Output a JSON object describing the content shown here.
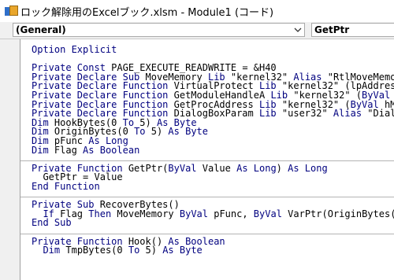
{
  "window": {
    "title": "ロック解除用のExcelブック.xlsm - Module1 (コード)",
    "icon": "vba-module-icon"
  },
  "toolbar": {
    "object_combo": "(General)",
    "procedure_combo": "GetPtr"
  },
  "colors": {
    "keyword": "#00007f",
    "text": "#000000",
    "gutter": "#f0f0f0",
    "divider": "#b4b4b4"
  },
  "code": [
    [
      {
        "t": "Option Explicit",
        "k": 1
      }
    ],
    [],
    [
      {
        "t": "Private Const",
        "k": 1
      },
      {
        "t": " PAGE_EXECUTE_READWRITE = &H40"
      }
    ],
    [
      {
        "t": "Private Declare Sub",
        "k": 1
      },
      {
        "t": " MoveMemory "
      },
      {
        "t": "Lib",
        "k": 1
      },
      {
        "t": " \"kernel32\" "
      },
      {
        "t": "Alias",
        "k": 1
      },
      {
        "t": " \"RtlMoveMemory"
      }
    ],
    [
      {
        "t": "Private Declare Function",
        "k": 1
      },
      {
        "t": " VirtualProtect "
      },
      {
        "t": "Lib",
        "k": 1
      },
      {
        "t": " \"kernel32\" (lpAddress "
      }
    ],
    [
      {
        "t": "Private Declare Function",
        "k": 1
      },
      {
        "t": " GetModuleHandleA "
      },
      {
        "t": "Lib",
        "k": 1
      },
      {
        "t": " \"kernel32\" ("
      },
      {
        "t": "ByVal",
        "k": 1
      },
      {
        "t": " lp"
      }
    ],
    [
      {
        "t": "Private Declare Function",
        "k": 1
      },
      {
        "t": " GetProcAddress "
      },
      {
        "t": "Lib",
        "k": 1
      },
      {
        "t": " \"kernel32\" ("
      },
      {
        "t": "ByVal",
        "k": 1
      },
      {
        "t": " hMod"
      }
    ],
    [
      {
        "t": "Private Declare Function",
        "k": 1
      },
      {
        "t": " DialogBoxParam "
      },
      {
        "t": "Lib",
        "k": 1
      },
      {
        "t": " \"user32\" "
      },
      {
        "t": "Alias",
        "k": 1
      },
      {
        "t": " \"Dialog"
      }
    ],
    [
      {
        "t": "Dim",
        "k": 1
      },
      {
        "t": " HookBytes(0 "
      },
      {
        "t": "To",
        "k": 1
      },
      {
        "t": " 5) "
      },
      {
        "t": "As Byte",
        "k": 1
      }
    ],
    [
      {
        "t": "Dim",
        "k": 1
      },
      {
        "t": " OriginBytes(0 "
      },
      {
        "t": "To",
        "k": 1
      },
      {
        "t": " 5) "
      },
      {
        "t": "As Byte",
        "k": 1
      }
    ],
    [
      {
        "t": "Dim",
        "k": 1
      },
      {
        "t": " pFunc "
      },
      {
        "t": "As Long",
        "k": 1
      }
    ],
    [
      {
        "t": "Dim",
        "k": 1
      },
      {
        "t": " Flag "
      },
      {
        "t": "As Boolean",
        "k": 1
      }
    ],
    [],
    [
      {
        "t": "Private Function",
        "k": 1
      },
      {
        "t": " GetPtr("
      },
      {
        "t": "ByVal",
        "k": 1
      },
      {
        "t": " Value "
      },
      {
        "t": "As Long",
        "k": 1
      },
      {
        "t": ") "
      },
      {
        "t": "As Long",
        "k": 1
      }
    ],
    [
      {
        "t": "  GetPtr = Value"
      }
    ],
    [
      {
        "t": "End Function",
        "k": 1
      }
    ],
    [],
    [
      {
        "t": "Private Sub",
        "k": 1
      },
      {
        "t": " RecoverBytes()"
      }
    ],
    [
      {
        "t": "  "
      },
      {
        "t": "If",
        "k": 1
      },
      {
        "t": " Flag "
      },
      {
        "t": "Then",
        "k": 1
      },
      {
        "t": " MoveMemory "
      },
      {
        "t": "ByVal",
        "k": 1
      },
      {
        "t": " pFunc, "
      },
      {
        "t": "ByVal",
        "k": 1
      },
      {
        "t": " VarPtr(OriginBytes(0)"
      }
    ],
    [
      {
        "t": "End Sub",
        "k": 1
      }
    ],
    [],
    [
      {
        "t": "Private Function",
        "k": 1
      },
      {
        "t": " Hook() "
      },
      {
        "t": "As Boolean",
        "k": 1
      }
    ],
    [
      {
        "t": "  "
      },
      {
        "t": "Dim",
        "k": 1
      },
      {
        "t": " TmpBytes(0 "
      },
      {
        "t": "To",
        "k": 1
      },
      {
        "t": " 5) "
      },
      {
        "t": "As Byte",
        "k": 1
      }
    ]
  ]
}
